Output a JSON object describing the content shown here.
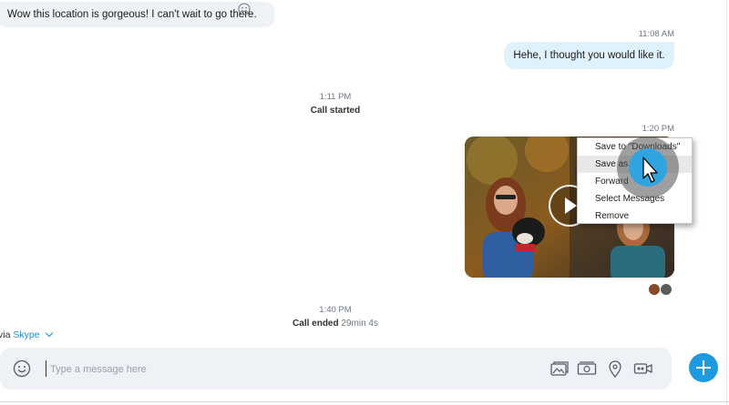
{
  "messages": {
    "incoming_text": "Wow this location is gorgeous! I can't wait to go there.",
    "outgoing_time": "11:08 AM",
    "outgoing_text": "Hehe, I thought you would like it.",
    "call_started_time": "1:11 PM",
    "call_started_label": "Call started",
    "video_time": "1:20 PM",
    "call_ended_time": "1:40 PM",
    "call_ended_label": "Call ended",
    "call_duration": "29min 4s"
  },
  "context_menu": {
    "items": [
      {
        "label": "Save to \"Downloads\""
      },
      {
        "label": "Save as..."
      },
      {
        "label": "Forward"
      },
      {
        "label": "Select Messages"
      },
      {
        "label": "Remove"
      }
    ],
    "hovered_index": 1
  },
  "footer": {
    "via_prefix": "via",
    "via_link": "Skype"
  },
  "composer": {
    "placeholder": "Type a message here",
    "value": ""
  },
  "icons": [
    "emoji-icon",
    "media-gallery-icon",
    "send-money-icon",
    "location-pin-icon",
    "video-message-icon",
    "plus-icon",
    "chevron-down-icon",
    "play-icon"
  ],
  "colors": {
    "accent": "#1e9be0",
    "incoming_bubble": "#eef1f6",
    "outgoing_bubble": "#dff1fb",
    "link": "#1f8bd1",
    "composer_bg": "#eef1f5"
  }
}
